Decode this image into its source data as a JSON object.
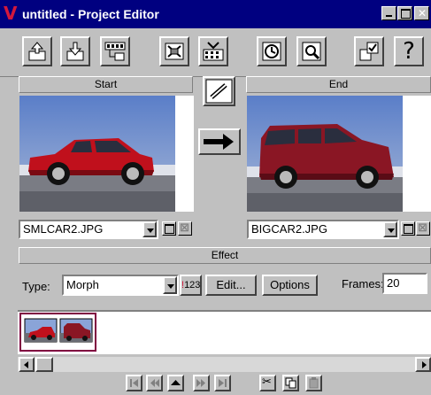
{
  "window": {
    "title": "untitled - Project Editor",
    "logo": "V",
    "logo_color": "#d4183c",
    "titlebar_color": "#000080"
  },
  "toolbar": {
    "icons": [
      "open-icon",
      "save-icon",
      "filmstrip-export-icon",
      "sequence-icon",
      "filmstrip-icon",
      "clock-icon",
      "preview-icon",
      "checkbox-icon",
      "help-icon"
    ],
    "help_label": "?"
  },
  "start": {
    "header": "Start",
    "file": "SMLCAR2.JPG"
  },
  "end": {
    "header": "End",
    "file": "BIGCAR2.JPG"
  },
  "effect": {
    "header": "Effect",
    "type_label": "Type:",
    "type_value": "Morph",
    "counter_label": "123",
    "edit_label": "Edit...",
    "options_label": "Options",
    "frames_label": "Frames:",
    "frames_value": "20"
  },
  "timeline": {
    "thumbnails": 2
  },
  "colors": {
    "face": "#c0c0c0",
    "accent": "#800040"
  }
}
